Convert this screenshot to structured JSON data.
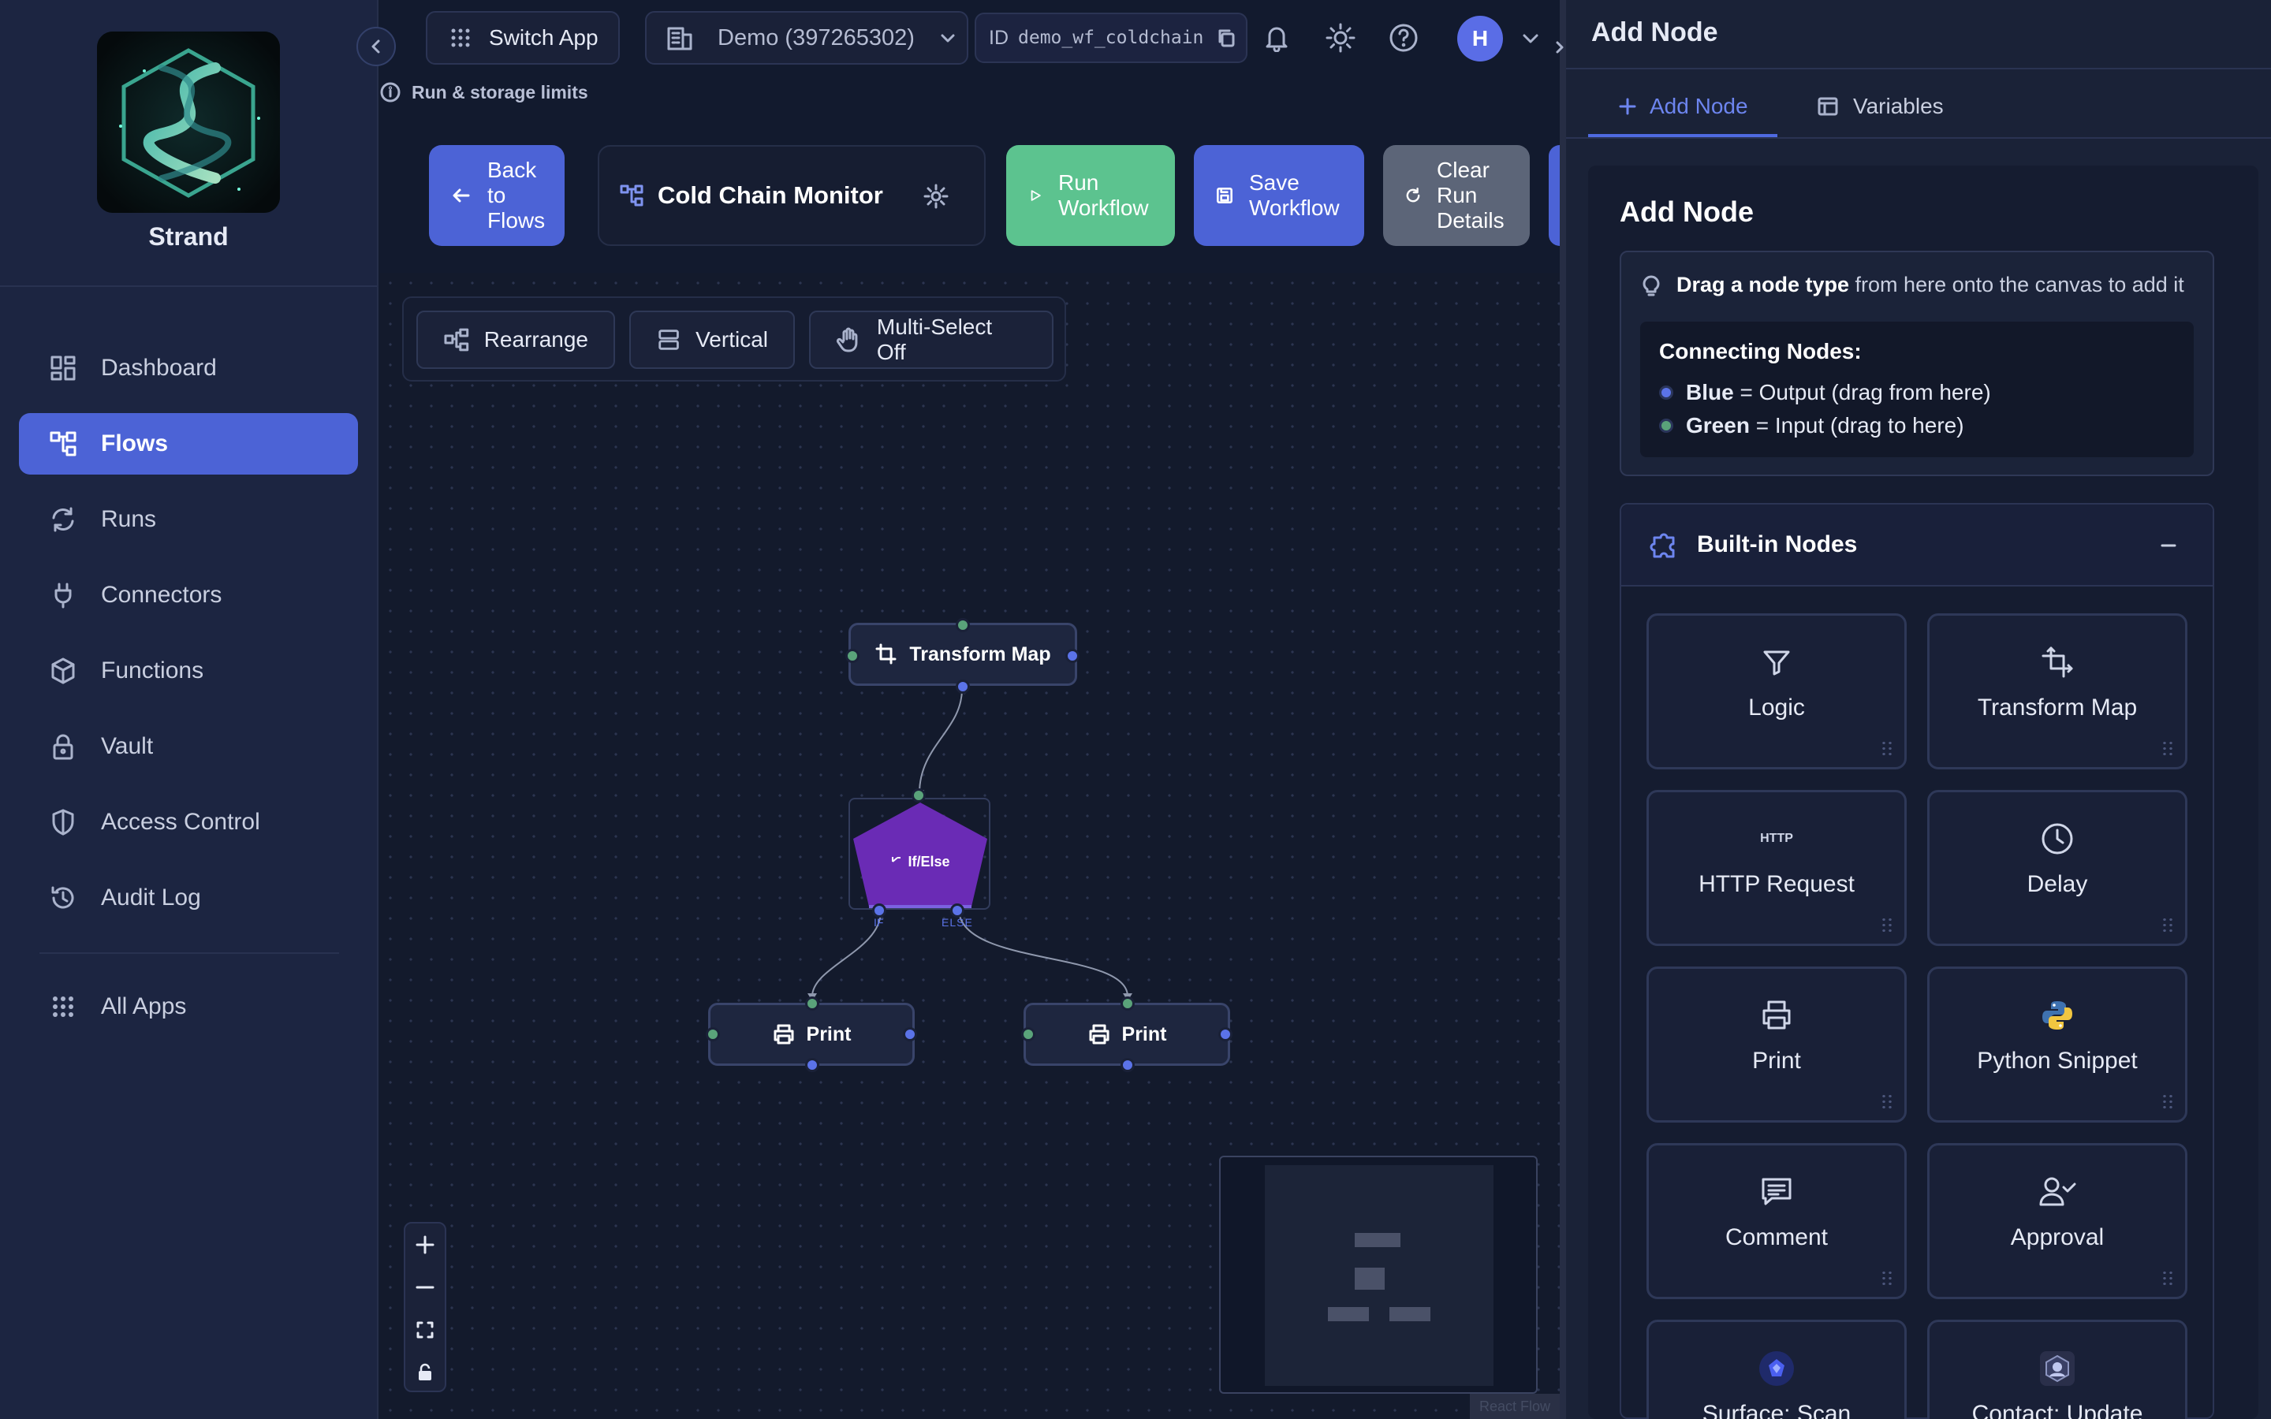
{
  "sidebar": {
    "brand": "Strand",
    "items": [
      {
        "label": "Dashboard",
        "icon": "dashboard-icon"
      },
      {
        "label": "Flows",
        "icon": "flows-icon",
        "active": true
      },
      {
        "label": "Runs",
        "icon": "runs-icon"
      },
      {
        "label": "Connectors",
        "icon": "plug-icon"
      },
      {
        "label": "Functions",
        "icon": "cube-icon"
      },
      {
        "label": "Vault",
        "icon": "lock-icon"
      },
      {
        "label": "Access Control",
        "icon": "shield-icon"
      },
      {
        "label": "Audit Log",
        "icon": "history-icon"
      }
    ],
    "all_apps": "All Apps"
  },
  "topbar": {
    "switch_app": "Switch App",
    "org": "Demo (397265302)",
    "id_prefix": "ID",
    "id_value": "demo_wf_coldchain",
    "avatar_initial": "H",
    "run_limits": "Run & storage limits"
  },
  "toolbar": {
    "back": [
      "Back",
      "to",
      "Flows"
    ],
    "workflow_name": "Cold Chain Monitor",
    "run": [
      "Run",
      "Workflow"
    ],
    "save": [
      "Save",
      "Workflow"
    ],
    "clear": [
      "Clear",
      "Run",
      "Details"
    ]
  },
  "canvas": {
    "tools": {
      "rearrange": "Rearrange",
      "vertical": "Vertical",
      "multiselect": "Multi-Select Off"
    },
    "nodes": {
      "transform": "Transform Map",
      "ifelse": "If/Else",
      "if_label": "IF",
      "else_label": "ELSE",
      "print_left": "Print",
      "print_right": "Print"
    },
    "attribution": "React Flow"
  },
  "panel": {
    "title": "Add Node",
    "tabs": [
      {
        "label": "Add Node",
        "active": true
      },
      {
        "label": "Variables"
      }
    ],
    "heading": "Add Node",
    "hint_bold": "Drag a node type",
    "hint_rest": " from here onto the canvas to add it",
    "connecting_title": "Connecting Nodes:",
    "blue_label": "Blue",
    "blue_desc": " = Output (drag from here)",
    "green_label": "Green",
    "green_desc": " = Input (drag to here)",
    "builtin_title": "Built-in Nodes",
    "node_types": [
      "Logic",
      "Transform Map",
      "HTTP Request",
      "Delay",
      "Print",
      "Python Snippet",
      "Comment",
      "Approval",
      "Surface: Scan",
      "Contact: Update"
    ],
    "http_icon_text": "HTTP"
  },
  "colors": {
    "accent": "#4c63d6",
    "run_green": "#5cc38f",
    "port_blue": "#5b73e8",
    "port_green": "#5aa37a",
    "ifelse_purple": "#6a2bb5"
  }
}
